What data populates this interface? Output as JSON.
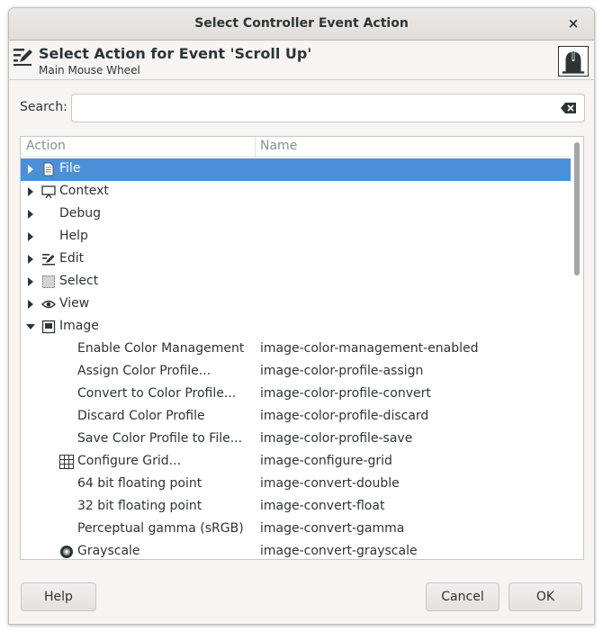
{
  "window": {
    "title": "Select Controller Event Action",
    "close_glyph": "×"
  },
  "header": {
    "title": "Select Action for Event 'Scroll Up'",
    "subtitle": "Main Mouse Wheel",
    "icon_left": "edit-icon",
    "icon_right": "mouse-icon"
  },
  "search": {
    "label": "Search:",
    "value": "",
    "placeholder": ""
  },
  "tree": {
    "columns": [
      "Action",
      "Name"
    ],
    "rows": [
      {
        "label": "File",
        "name": "",
        "expander": "collapsed",
        "icon": "file-icon",
        "level": 0,
        "selected": true
      },
      {
        "label": "Context",
        "name": "",
        "expander": "collapsed",
        "icon": "context-icon",
        "level": 0
      },
      {
        "label": "Debug",
        "name": "",
        "expander": "collapsed",
        "icon": "",
        "level": 0
      },
      {
        "label": "Help",
        "name": "",
        "expander": "collapsed",
        "icon": "",
        "level": 0
      },
      {
        "label": "Edit",
        "name": "",
        "expander": "collapsed",
        "icon": "edit-icon",
        "level": 0
      },
      {
        "label": "Select",
        "name": "",
        "expander": "collapsed",
        "icon": "select-icon",
        "level": 0
      },
      {
        "label": "View",
        "name": "",
        "expander": "collapsed",
        "icon": "eye-icon",
        "level": 0
      },
      {
        "label": "Image",
        "name": "",
        "expander": "expanded",
        "icon": "image-icon",
        "level": 0
      },
      {
        "label": "Enable Color Management",
        "name": "image-color-management-enabled",
        "level": 1,
        "icon": ""
      },
      {
        "label": "Assign Color Profile...",
        "name": "image-color-profile-assign",
        "level": 1,
        "icon": ""
      },
      {
        "label": "Convert to Color Profile...",
        "name": "image-color-profile-convert",
        "level": 1,
        "icon": ""
      },
      {
        "label": "Discard Color Profile",
        "name": "image-color-profile-discard",
        "level": 1,
        "icon": ""
      },
      {
        "label": "Save Color Profile to File...",
        "name": "image-color-profile-save",
        "level": 1,
        "icon": ""
      },
      {
        "label": "Configure Grid...",
        "name": "image-configure-grid",
        "level": 1,
        "icon": "grid-icon"
      },
      {
        "label": "64 bit floating point",
        "name": "image-convert-double",
        "level": 1,
        "icon": ""
      },
      {
        "label": "32 bit floating point",
        "name": "image-convert-float",
        "level": 1,
        "icon": ""
      },
      {
        "label": "Perceptual gamma (sRGB)",
        "name": "image-convert-gamma",
        "level": 1,
        "icon": ""
      },
      {
        "label": "Grayscale",
        "name": "image-convert-grayscale",
        "level": 1,
        "icon": "grayscale-icon"
      }
    ]
  },
  "buttons": {
    "help": "Help",
    "cancel": "Cancel",
    "ok": "OK"
  },
  "colors": {
    "selection": "#4a90d9",
    "background": "#f6f5f4"
  }
}
